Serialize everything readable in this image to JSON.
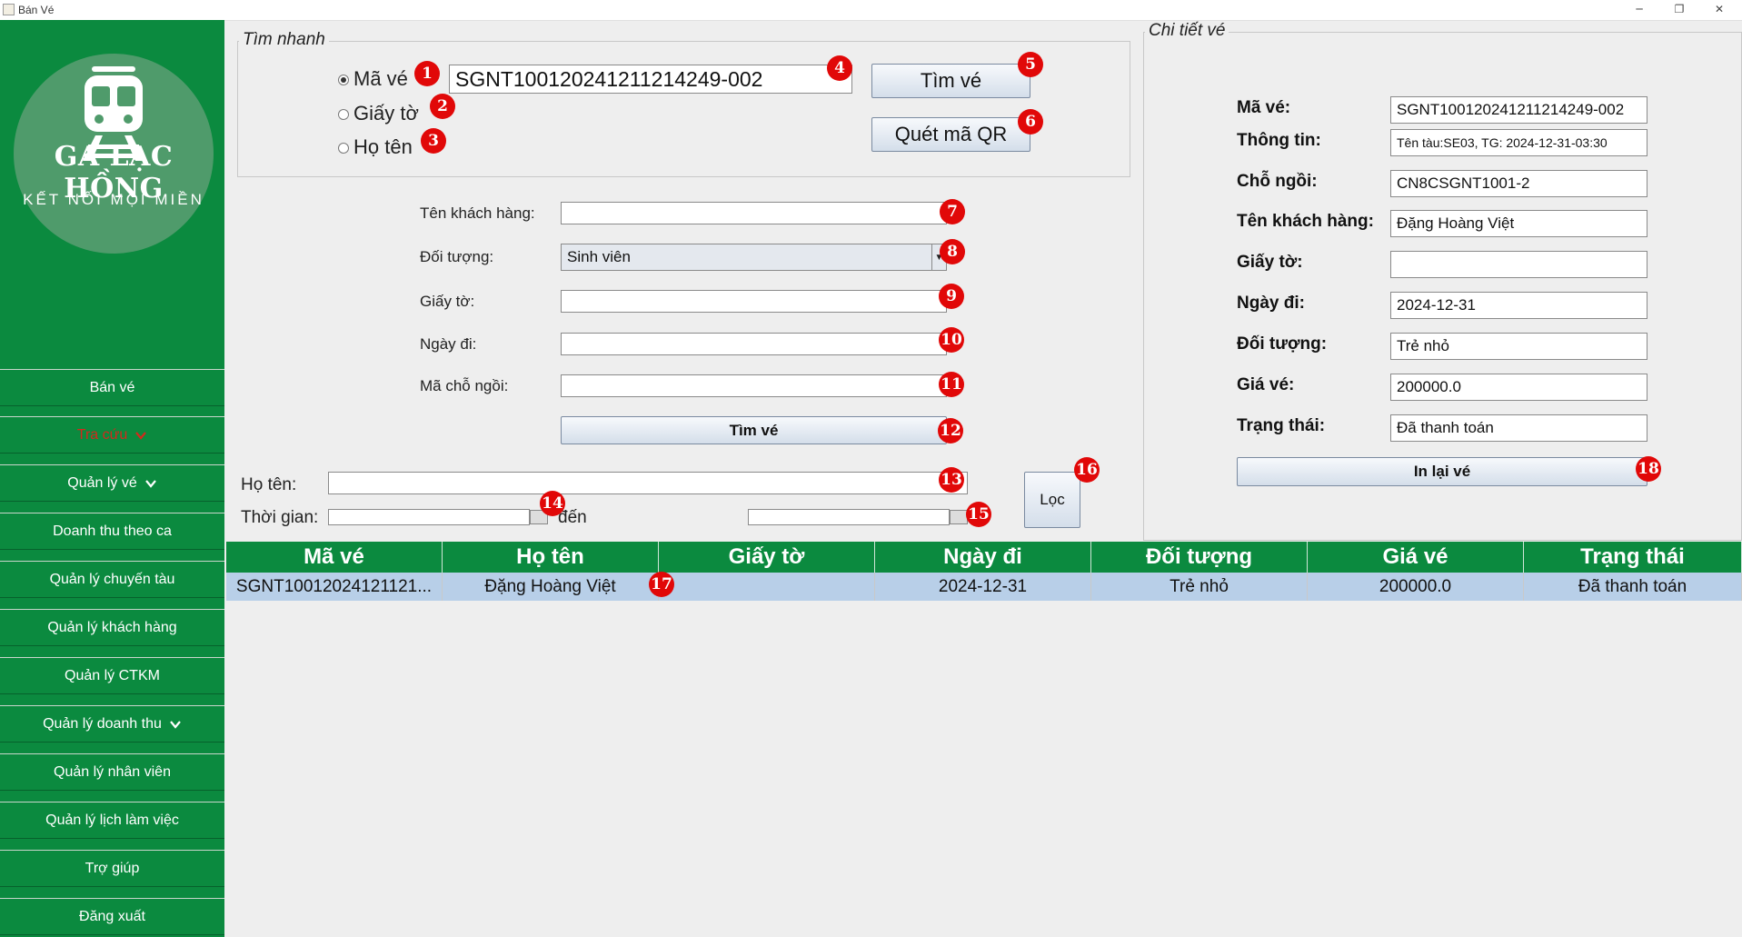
{
  "window": {
    "title": "Bán Vé",
    "minimize": "─",
    "restore": "❐",
    "close": "✕"
  },
  "sidebar": {
    "logo_title": "GA LẠC HỒNG",
    "logo_subtitle": "KẾT NỐI MỌI MIỀN",
    "items": [
      {
        "label": "Bán vé",
        "chevron": false,
        "active": false
      },
      {
        "label": "Tra cứu",
        "chevron": true,
        "active": true
      },
      {
        "label": "Quản lý vé",
        "chevron": true,
        "active": false
      },
      {
        "label": "Doanh thu theo ca",
        "chevron": false,
        "active": false
      },
      {
        "label": "Quản lý chuyến tàu",
        "chevron": false,
        "active": false
      },
      {
        "label": "Quản lý khách hàng",
        "chevron": false,
        "active": false
      },
      {
        "label": "Quản lý CTKM",
        "chevron": false,
        "active": false
      },
      {
        "label": "Quản lý doanh thu",
        "chevron": true,
        "active": false
      },
      {
        "label": "Quản lý nhân viên",
        "chevron": false,
        "active": false
      },
      {
        "label": "Quản lý lịch làm việc",
        "chevron": false,
        "active": false
      },
      {
        "label": "Trợ giúp",
        "chevron": false,
        "active": false
      },
      {
        "label": "Đăng xuất",
        "chevron": false,
        "active": false
      }
    ],
    "colors": {
      "background": "#0b8a3f",
      "active_text": "#d4281c"
    }
  },
  "quick_search": {
    "title": "Tìm nhanh",
    "radio_ma_ve": "Mã vé",
    "radio_giay_to": "Giấy tờ",
    "radio_ho_ten": "Họ tên",
    "selected": "Mã vé",
    "code_value": "SGNT10012024121121424​9-002",
    "find_button": "Tìm vé",
    "qr_button": "Quét mã QR"
  },
  "search_form": {
    "ten_khach_hang_label": "Tên khách hàng:",
    "ten_khach_hang_value": "",
    "doi_tuong_label": "Đối tượng:",
    "doi_tuong_value": "Sinh viên",
    "giay_to_label": "Giấy tờ:",
    "giay_to_value": "",
    "ngay_di_label": "Ngày đi:",
    "ngay_di_value": "",
    "ma_cho_ngoi_label": "Mã chỗ ngồi:",
    "ma_cho_ngoi_value": "",
    "find_button": "Tìm vé"
  },
  "filter": {
    "ho_ten_label": "Họ tên:",
    "ho_ten_value": "",
    "thoi_gian_label": "Thời gian:",
    "den_label": "đến",
    "from_value": "",
    "to_value": "",
    "loc_button": "Lọc"
  },
  "detail": {
    "title": "Chi tiết vé",
    "fields": [
      {
        "label": "Mã vé:",
        "value": "SGNT10012024121121424​9-002"
      },
      {
        "label": "Thông tin:",
        "value": "Tên tàu:SE03, TG: 2024-12-31-03:30"
      },
      {
        "label": "Chỗ ngồi:",
        "value": "CN8CSGNT1001-2"
      },
      {
        "label": "Tên khách hàng:",
        "value": "Đặng Hoàng Việt"
      },
      {
        "label": "Giấy tờ:",
        "value": ""
      },
      {
        "label": "Ngày đi:",
        "value": "2024-12-31"
      },
      {
        "label": "Đối tượng:",
        "value": "Trẻ nhỏ"
      },
      {
        "label": "Giá vé:",
        "value": "200000.0"
      },
      {
        "label": "Trạng thái:",
        "value": "Đã thanh toán"
      }
    ],
    "reprint_button": "In lại vé"
  },
  "table": {
    "columns": [
      "Mã vé",
      "Họ tên",
      "Giấy tờ",
      "Ngày đi",
      "Đối tượng",
      "Giá vé",
      "Trạng thái"
    ],
    "rows": [
      [
        "SGNT10012024121121...",
        "Đặng Hoàng Việt",
        "",
        "2024-12-31",
        "Trẻ nhỏ",
        "200000.0",
        "Đã thanh toán"
      ]
    ]
  },
  "annotations": {
    "badges": [
      "1",
      "2",
      "3",
      "4",
      "5",
      "6",
      "7",
      "8",
      "9",
      "10",
      "11",
      "12",
      "13",
      "14",
      "15",
      "16",
      "17",
      "18"
    ],
    "color": "#e10808"
  }
}
